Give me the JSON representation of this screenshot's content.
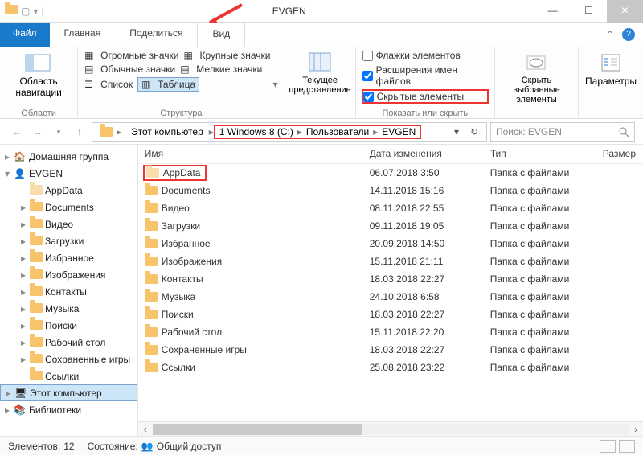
{
  "titlebar": {
    "title": "EVGEN"
  },
  "ribbon_tabs": {
    "file": "Файл",
    "home": "Главная",
    "share": "Поделиться",
    "view": "Вид"
  },
  "ribbon": {
    "nav": {
      "pane": "Область навигации",
      "group": "Области"
    },
    "structure": {
      "huge": "Огромные значки",
      "large": "Крупные значки",
      "medium": "Обычные значки",
      "small": "Мелкие значки",
      "list": "Список",
      "table": "Таблица",
      "group": "Структура"
    },
    "currview": {
      "label": "Текущее представление",
      "group": ""
    },
    "showhide": {
      "flags": "Флажки элементов",
      "ext": "Расширения имен файлов",
      "hidden": "Скрытые элементы",
      "group": "Показать или скрыть"
    },
    "hidesel": {
      "label": "Скрыть выбранные элементы"
    },
    "options": {
      "label": "Параметры"
    }
  },
  "breadcrumb": {
    "thispc": "Этот компьютер",
    "drive": "1 Windows 8 (C:)",
    "users": "Пользователи",
    "folder": "EVGEN"
  },
  "search": {
    "placeholder": "Поиск: EVGEN"
  },
  "tree": {
    "homegroup": "Домашняя группа",
    "evgen": "EVGEN",
    "items": [
      "AppData",
      "Documents",
      "Видео",
      "Загрузки",
      "Избранное",
      "Изображения",
      "Контакты",
      "Музыка",
      "Поиски",
      "Рабочий стол",
      "Сохраненные игры",
      "Ссылки"
    ],
    "thispc": "Этот компьютер",
    "libraries": "Библиотеки"
  },
  "columns": {
    "name": "Имя",
    "date": "Дата изменения",
    "type": "Тип",
    "size": "Размер"
  },
  "rows": [
    {
      "name": "AppData",
      "date": "06.07.2018 3:50",
      "type": "Папка с файлами",
      "hl": true,
      "faded": true
    },
    {
      "name": "Documents",
      "date": "14.11.2018 15:16",
      "type": "Папка с файлами"
    },
    {
      "name": "Видео",
      "date": "08.11.2018 22:55",
      "type": "Папка с файлами"
    },
    {
      "name": "Загрузки",
      "date": "09.11.2018 19:05",
      "type": "Папка с файлами"
    },
    {
      "name": "Избранное",
      "date": "20.09.2018 14:50",
      "type": "Папка с файлами"
    },
    {
      "name": "Изображения",
      "date": "15.11.2018 21:11",
      "type": "Папка с файлами"
    },
    {
      "name": "Контакты",
      "date": "18.03.2018 22:27",
      "type": "Папка с файлами"
    },
    {
      "name": "Музыка",
      "date": "24.10.2018 6:58",
      "type": "Папка с файлами"
    },
    {
      "name": "Поиски",
      "date": "18.03.2018 22:27",
      "type": "Папка с файлами"
    },
    {
      "name": "Рабочий стол",
      "date": "15.11.2018 22:20",
      "type": "Папка с файлами"
    },
    {
      "name": "Сохраненные игры",
      "date": "18.03.2018 22:27",
      "type": "Папка с файлами"
    },
    {
      "name": "Ссылки",
      "date": "25.08.2018 23:22",
      "type": "Папка с файлами"
    }
  ],
  "status": {
    "elems_label": "Элементов:",
    "elems_count": "12",
    "state_label": "Состояние:",
    "state_value": "Общий доступ"
  }
}
